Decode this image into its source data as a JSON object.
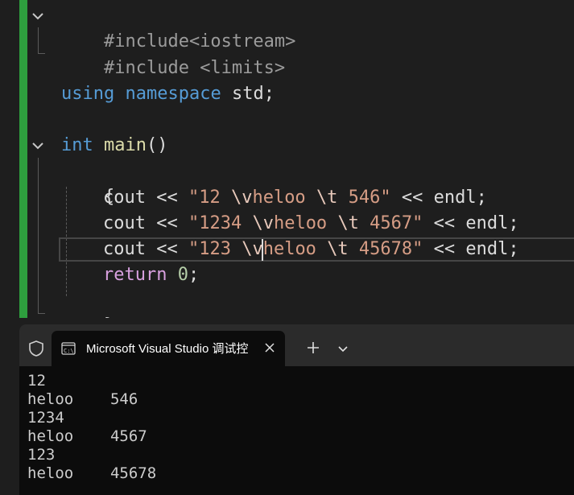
{
  "editor": {
    "include_iostream": "#include<iostream>",
    "include_limits": "#include <limits>",
    "using_kw": "using",
    "namespace_kw": "namespace",
    "std_name": " std",
    "semicolon": ";",
    "int_kw": "int",
    "main_fn": "main",
    "parens": "()",
    "open_brace": "{",
    "close_brace": "}",
    "cout1_pre": "cout << ",
    "cout1_q1": "\"12 ",
    "cout1_esc1": "\\v",
    "cout1_mid": "heloo ",
    "cout1_esc2": "\\t",
    "cout1_q2": " 546\"",
    "cout1_post": " << endl;",
    "cout2_pre": "cout << ",
    "cout2_q1": "\"1234 ",
    "cout2_esc1": "\\v",
    "cout2_mid": "heloo ",
    "cout2_esc2": "\\t",
    "cout2_q2": " 4567\"",
    "cout2_post": " << endl;",
    "cout3_pre": "cout << ",
    "cout3_q1": "\"123 ",
    "cout3_esc1": "\\v",
    "cout3_mid": "heloo ",
    "cout3_esc2": "\\t",
    "cout3_q2": " 45678\"",
    "cout3_post": " << endl;",
    "return_kw": "return",
    "return_val": "0",
    "gutter_color": "#2e9e3e"
  },
  "terminal": {
    "tab_title": "Microsoft Visual Studio 调试控",
    "tab_icon": "console-icon",
    "output": [
      "12",
      "heloo    546",
      "1234",
      "heloo    4567",
      "123",
      "heloo    45678"
    ]
  }
}
